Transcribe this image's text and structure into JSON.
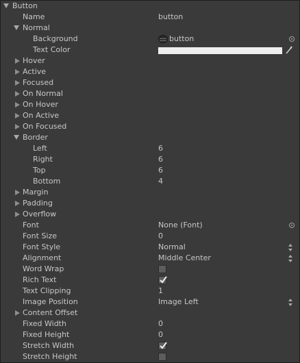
{
  "header": {
    "title": "Button"
  },
  "name": {
    "label": "Name",
    "value": "button"
  },
  "normal": {
    "label": "Normal",
    "background": {
      "label": "Background",
      "value": "button"
    },
    "text_color": {
      "label": "Text Color",
      "color": "#eeeeee"
    }
  },
  "states": [
    "Hover",
    "Active",
    "Focused",
    "On Normal",
    "On Hover",
    "On Active",
    "On Focused"
  ],
  "border": {
    "label": "Border",
    "left": {
      "label": "Left",
      "value": "6"
    },
    "right": {
      "label": "Right",
      "value": "6"
    },
    "top": {
      "label": "Top",
      "value": "6"
    },
    "bottom": {
      "label": "Bottom",
      "value": "4"
    }
  },
  "sections": [
    "Margin",
    "Padding",
    "Overflow"
  ],
  "font": {
    "label": "Font",
    "value": "None (Font)"
  },
  "font_size": {
    "label": "Font Size",
    "value": "0"
  },
  "font_style": {
    "label": "Font Style",
    "value": "Normal"
  },
  "alignment": {
    "label": "Alignment",
    "value": "Middle Center"
  },
  "word_wrap": {
    "label": "Word Wrap",
    "checked": false
  },
  "rich_text": {
    "label": "Rich Text",
    "checked": true
  },
  "text_clipping": {
    "label": "Text Clipping",
    "value": "1"
  },
  "image_position": {
    "label": "Image Position",
    "value": "Image Left"
  },
  "content_offset": {
    "label": "Content Offset"
  },
  "fixed_width": {
    "label": "Fixed Width",
    "value": "0"
  },
  "fixed_height": {
    "label": "Fixed Height",
    "value": "0"
  },
  "stretch_width": {
    "label": "Stretch Width",
    "checked": true
  },
  "stretch_height": {
    "label": "Stretch Height",
    "checked": false
  },
  "colors": {
    "panel_bg": "#3a3a3a",
    "text": "#c8c8c8",
    "check_bg": "#5d5d5d"
  }
}
